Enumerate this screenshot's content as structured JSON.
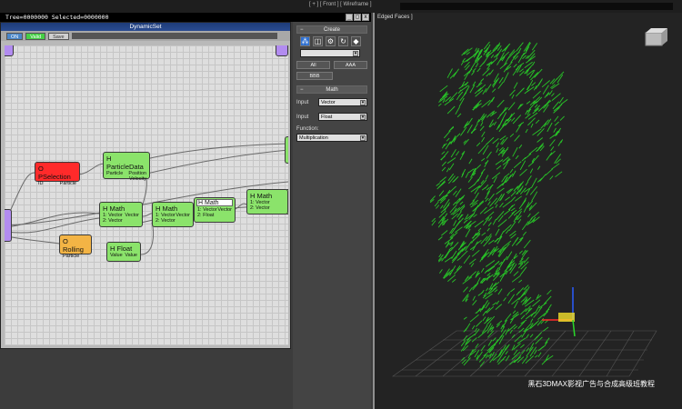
{
  "topbar": {
    "viewport_label": "[ + ] [ Front ] [ Wireframe ]"
  },
  "tree_title": "Tree=0000000  Selected=0000000",
  "window_buttons": [
    "_",
    "□",
    "x"
  ],
  "dyn_window": {
    "title": "DynamicSet",
    "toolbar": {
      "on_label": "ON",
      "valid_label": "Valid",
      "save_label": "Save"
    }
  },
  "nodes": {
    "pselection": {
      "title": "O PSelection",
      "port_left": "ID",
      "port_right": "Particle"
    },
    "particledata": {
      "title": "H ParticleData",
      "ports": [
        "Particle",
        "Position",
        "Velocity"
      ]
    },
    "math1": {
      "title": "H Math",
      "in1": "1: Vector",
      "in2": "2: Vector",
      "out": "Vector"
    },
    "math2": {
      "title": "H Math",
      "in1": "1: Vector",
      "in2": "2: Vector",
      "out": "Vector"
    },
    "math3": {
      "title": "H Math",
      "in1": "1: Vector",
      "in2": "2: Float",
      "out": "Vector"
    },
    "math4": {
      "title": "H Math",
      "in1": "1: Vector",
      "in2": "2: Vector",
      "out": ""
    },
    "rolling": {
      "title": "O Rolling",
      "port": "Particle"
    },
    "float": {
      "title": "H Float",
      "port_left": "Value",
      "port_right": "Value"
    }
  },
  "cmd_panel": {
    "create_title": "Create",
    "dropdown_value": "",
    "btn_all": "All",
    "btn_aaa": "AAA",
    "btn_bbb": "BBB",
    "math_title": "Math",
    "input1_label": "Input",
    "input1_value": "Vector",
    "input2_label": "Input",
    "input2_value": "Float",
    "function_label": "Function:",
    "function_value": "Multiplication"
  },
  "viewport": {
    "title": "Edged Faces ]",
    "watermark": "黑石3DMAX影视广告与合成高级班教程"
  },
  "colors": {
    "node_green": "#8be36b",
    "node_red": "#ff2a2a",
    "node_orange": "#f3b445",
    "particles": "#27c227"
  }
}
